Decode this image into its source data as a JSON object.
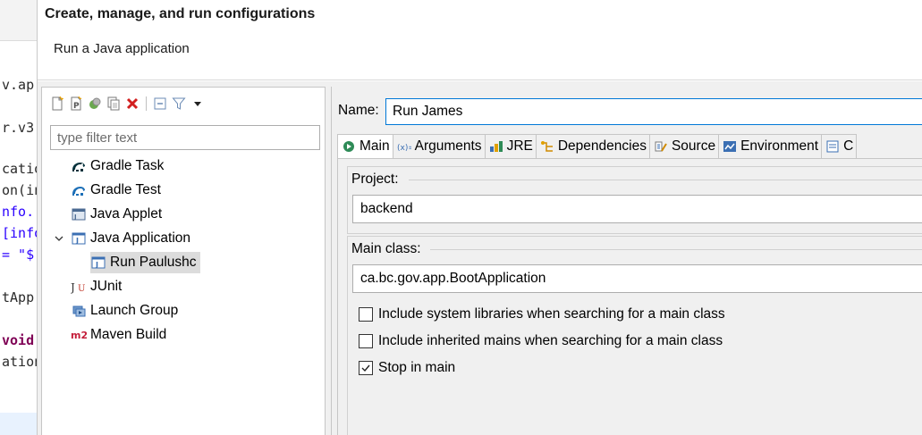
{
  "editor": {
    "lines": [
      {
        "text": "v.ap",
        "style": "plain"
      },
      {
        "text": "r.v3",
        "style": "plain"
      },
      {
        "text": "catio",
        "style": "plain"
      },
      {
        "text": "on(in",
        "style": "plain"
      },
      {
        "text": "nfo.",
        "style": "blue"
      },
      {
        "text": "[info",
        "style": "blue"
      },
      {
        "text": "= \"$",
        "style": "blue"
      },
      {
        "text": "tApp.",
        "style": "plain"
      },
      {
        "text": "void",
        "style": "kw"
      },
      {
        "text": "ation",
        "style": "plain"
      }
    ]
  },
  "dialog": {
    "title": "Create, manage, and run configurations",
    "subtitle": "Run a Java application"
  },
  "toolbar": {
    "icons": [
      "new-configuration-icon",
      "new-prototype-icon",
      "export-icon",
      "duplicate-icon",
      "delete-icon",
      "collapse-all-icon",
      "filter-icon",
      "view-menu-icon"
    ]
  },
  "filter": {
    "placeholder": "type filter text",
    "value": ""
  },
  "tree": {
    "items": [
      {
        "label": "Gradle Task",
        "icon": "gradle-task-icon"
      },
      {
        "label": "Gradle Test",
        "icon": "gradle-test-icon"
      },
      {
        "label": "Java Applet",
        "icon": "java-applet-icon"
      },
      {
        "label": "Java Application",
        "icon": "java-application-icon"
      },
      {
        "label": "Run Paulushc",
        "icon": "run-config-icon"
      },
      {
        "label": "JUnit",
        "icon": "junit-icon"
      },
      {
        "label": "Launch Group",
        "icon": "launch-group-icon"
      },
      {
        "label": "Maven Build",
        "icon": "maven-icon"
      }
    ]
  },
  "config": {
    "name_label": "Name:",
    "name_value": "Run James",
    "tabs": [
      {
        "label": "Main",
        "icon": "main-tab-icon"
      },
      {
        "label": "Arguments",
        "icon": "arguments-icon"
      },
      {
        "label": "JRE",
        "icon": "jre-icon"
      },
      {
        "label": "Dependencies",
        "icon": "dependencies-icon"
      },
      {
        "label": "Source",
        "icon": "source-icon"
      },
      {
        "label": "Environment",
        "icon": "environment-icon"
      },
      {
        "label": "C",
        "icon": "common-icon"
      }
    ],
    "project_label": "Project:",
    "project_value": "backend",
    "main_class_label": "Main class:",
    "main_class_value": "ca.bc.gov.app.BootApplication",
    "options": [
      {
        "label": "Include system libraries when searching for a main class",
        "checked": false
      },
      {
        "label": "Include inherited mains when searching for a main class",
        "checked": false
      },
      {
        "label": "Stop in main",
        "checked": true
      }
    ]
  },
  "colors": {
    "accent": "#0078d7",
    "selection": "#dcdcdc",
    "panel": "#f0f0f0"
  }
}
